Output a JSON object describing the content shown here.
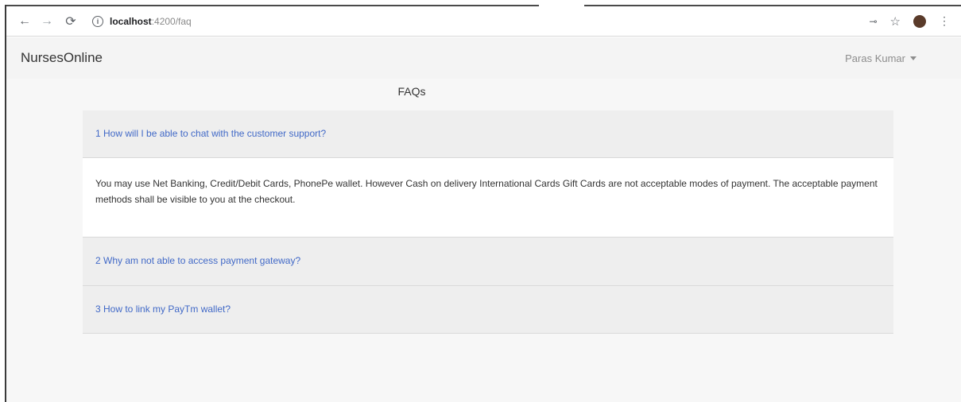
{
  "browser": {
    "url_host": "localhost",
    "url_path": ":4200/faq",
    "icons": {
      "back": "arrow-left-icon",
      "forward": "arrow-right-icon",
      "reload": "reload-icon",
      "info": "info-icon",
      "key": "key-icon",
      "bookmark": "star-icon",
      "menu": "kebab-menu-icon"
    }
  },
  "header": {
    "brand": "NursesOnline",
    "user_name": "Paras Kumar"
  },
  "main": {
    "title": "FAQs",
    "faqs": [
      {
        "question": "1 How will I be able to chat with the customer support?",
        "answer": "You may use Net Banking, Credit/Debit Cards, PhonePe wallet. However Cash on delivery International Cards Gift Cards are not acceptable modes of payment. The acceptable payment methods shall be visible to you at the checkout.",
        "expanded": true
      },
      {
        "question": "2 Why am not able to access payment gateway?",
        "expanded": false
      },
      {
        "question": "3 How to link my PayTm wallet?",
        "expanded": false
      }
    ]
  },
  "colors": {
    "link": "#4169c7",
    "header_bg": "#f4f4f4",
    "accordion_bg": "#eeeeee"
  }
}
